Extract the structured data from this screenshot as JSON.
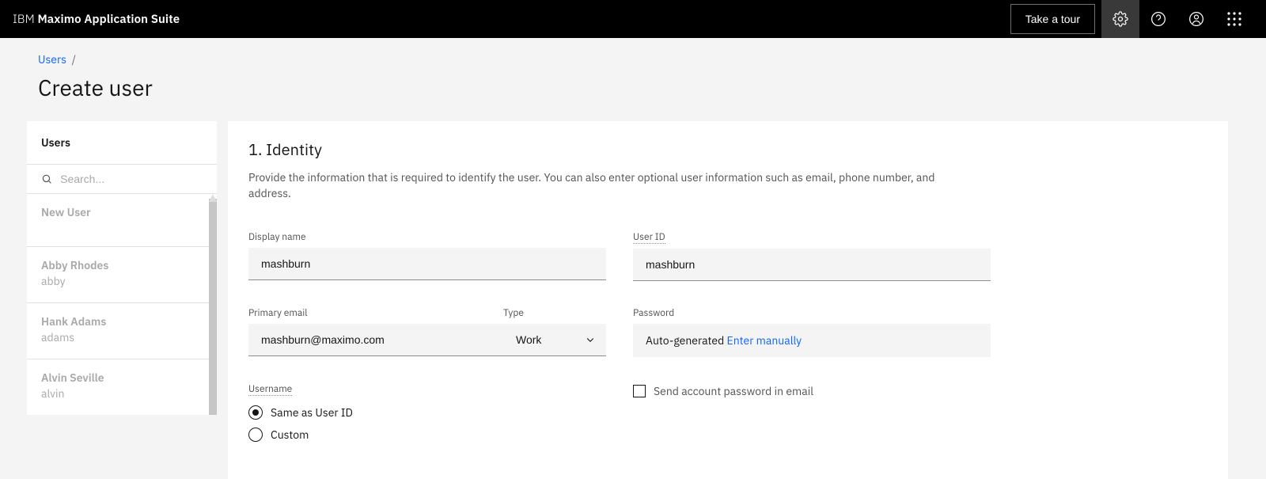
{
  "header": {
    "brand_prefix": "IBM",
    "brand_bold": "Maximo Application Suite",
    "tour_label": "Take a tour"
  },
  "breadcrumb": {
    "link": "Users",
    "sep": "/"
  },
  "page": {
    "title": "Create user"
  },
  "sidebar": {
    "title": "Users",
    "search_placeholder": "Search...",
    "items": [
      {
        "name": "New User",
        "sub": ""
      },
      {
        "name": "Abby Rhodes",
        "sub": "abby"
      },
      {
        "name": "Hank Adams",
        "sub": "adams"
      },
      {
        "name": "Alvin Seville",
        "sub": "alvin"
      }
    ]
  },
  "form": {
    "section_title": "1. Identity",
    "section_desc": "Provide the information that is required to identify the user. You can also enter optional user information such as email, phone number, and address.",
    "display_name": {
      "label": "Display name",
      "value": "mashburn"
    },
    "user_id": {
      "label": "User ID",
      "value": "mashburn"
    },
    "primary_email": {
      "label": "Primary email",
      "value": "mashburn@maximo.com"
    },
    "email_type": {
      "label": "Type",
      "value": "Work"
    },
    "password": {
      "label": "Password",
      "value": "Auto-generated",
      "link": "Enter manually"
    },
    "username": {
      "label": "Username",
      "option_same": "Same as User ID",
      "option_custom": "Custom",
      "selected": "same"
    },
    "send_email": {
      "label": "Send account password in email",
      "checked": false
    }
  }
}
